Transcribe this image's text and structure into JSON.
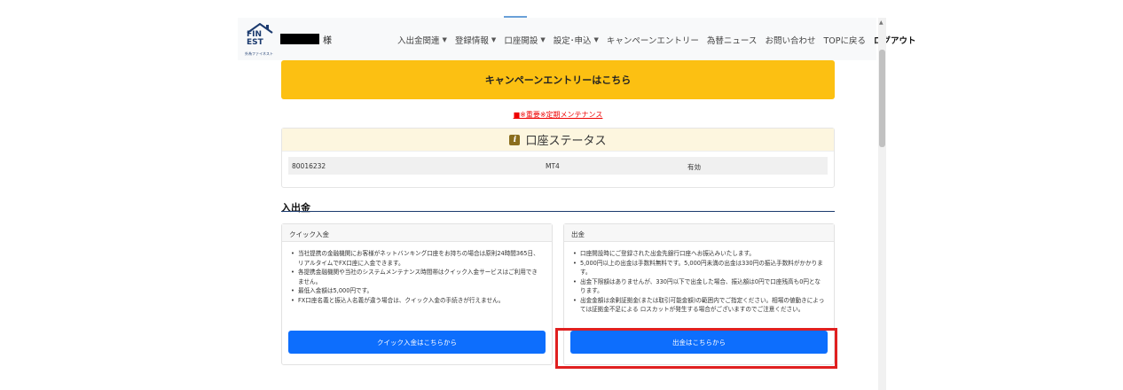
{
  "header": {
    "logo_text": [
      "FIN",
      "EST"
    ],
    "logo_sub": "外為ファイネスト",
    "user_suffix": "様",
    "nav": [
      {
        "label": "入出金関連",
        "dropdown": true
      },
      {
        "label": "登録情報",
        "dropdown": true
      },
      {
        "label": "口座開設",
        "dropdown": true
      },
      {
        "label": "設定･申込",
        "dropdown": true
      },
      {
        "label": "キャンペーンエントリー",
        "dropdown": false
      },
      {
        "label": "為替ニュース",
        "dropdown": false
      },
      {
        "label": "お問い合わせ",
        "dropdown": false
      },
      {
        "label": "TOPに戻る",
        "dropdown": false
      }
    ],
    "logout": "ログアウト"
  },
  "campaign_button": "キャンペーンエントリーはこちら",
  "maintenance_link": "■※重要※定期メンテナンス",
  "account_status": {
    "title": "口座ステータス",
    "row": {
      "account": "80016232",
      "platform": "MT4",
      "state": "有効"
    }
  },
  "deposit_section": {
    "title": "入出金",
    "quick_deposit": {
      "header": "クイック入金",
      "items": [
        "当社提携の金融機関にお客様がネットバンキング口座をお持ちの場合は原則24時間365日、リアルタイムでFX口座に入金できます。",
        "各提携金融機関や当社のシステムメンテナンス時間帯はクイック入金サービスはご利用できません。",
        "最低入金額は5,000円です。",
        "FX口座名義と振込人名義が違う場合は、クイック入金の手続きが行えません。"
      ],
      "button": "クイック入金はこちらから"
    },
    "withdrawal": {
      "header": "出金",
      "items": [
        "口座開設時にご登録された出金先銀行口座へお振込みいたします。",
        "5,000円以上の出金は手数料無料です。5,000円未満の出金は330円の振込手数料がかかります。",
        "出金下限額はありませんが、330円以下で出金した場合、振込額は0円で口座残高も0円となります。",
        "出金金額は余剰証拠金(または取引可能金額)の範囲内でご指定ください。相場の値動きによっては証拠金不足による ロスカットが発生する場合がございますのでご注意ください。"
      ],
      "button": "出金はこちらから"
    }
  },
  "colors": {
    "accent_yellow": "#fcc012",
    "button_blue": "#0d6efd",
    "highlight_red": "#e02020",
    "navy": "#1b3a6e"
  },
  "icons": [
    "caret-down-icon",
    "info-icon",
    "house-logo-icon"
  ]
}
